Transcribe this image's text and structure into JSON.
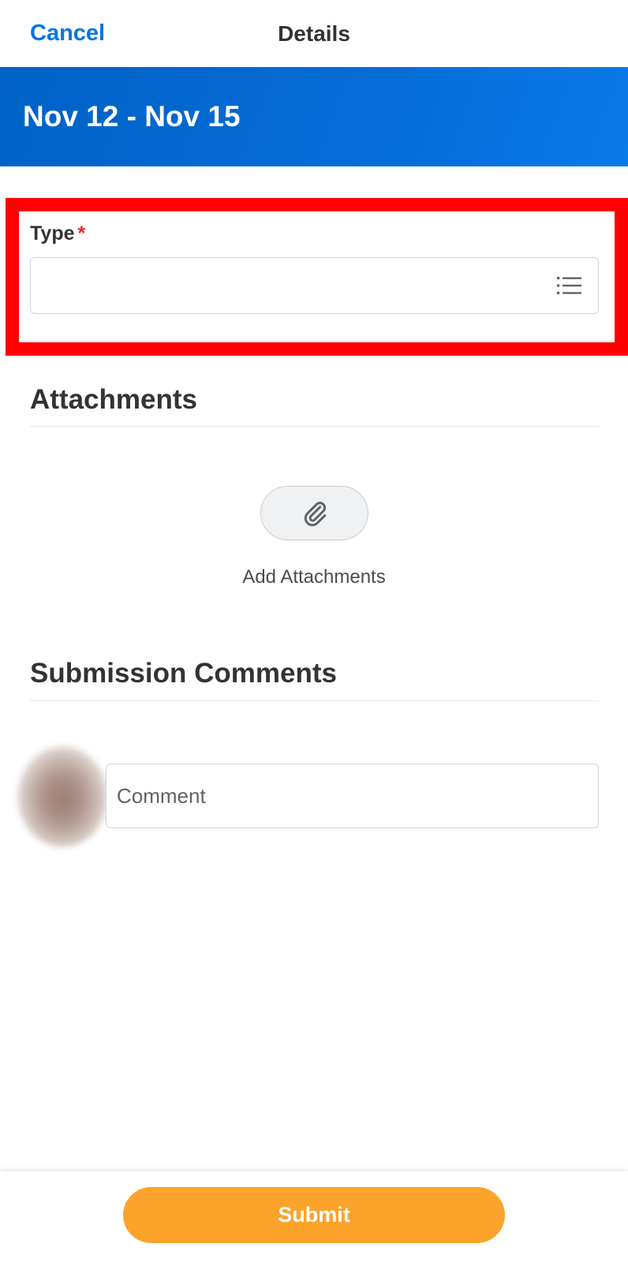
{
  "topnav": {
    "cancel_label": "Cancel",
    "title": "Details"
  },
  "banner": {
    "date_range": "Nov 12 - Nov 15"
  },
  "type_field": {
    "label": "Type",
    "required_mark": "*",
    "value": "",
    "icon": "list-icon"
  },
  "attachments": {
    "heading": "Attachments",
    "add_label": "Add Attachments",
    "icon": "paperclip-icon"
  },
  "comments": {
    "heading": "Submission Comments",
    "placeholder": "Comment"
  },
  "footer": {
    "submit_label": "Submit"
  },
  "colors": {
    "link_blue": "#0875e1",
    "banner_blue": "#0062c7",
    "highlight_red": "#ff0000",
    "required_red": "#de2e21",
    "submit_orange": "#fca32b"
  }
}
